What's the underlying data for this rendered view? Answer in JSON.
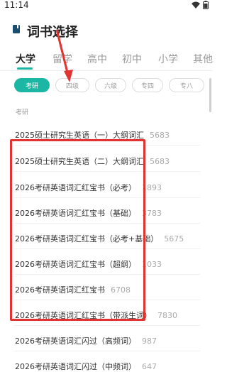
{
  "status": {
    "time": "11:14"
  },
  "header": {
    "title": "词书选择"
  },
  "tabs": [
    {
      "label": "大学",
      "active": true
    },
    {
      "label": "留学",
      "active": false
    },
    {
      "label": "高中",
      "active": false
    },
    {
      "label": "初中",
      "active": false
    },
    {
      "label": "小学",
      "active": false
    },
    {
      "label": "其他",
      "active": false
    }
  ],
  "chips": [
    {
      "label": "考研",
      "active": true
    },
    {
      "label": "四级",
      "active": false
    },
    {
      "label": "六级",
      "active": false
    },
    {
      "label": "专四",
      "active": false
    },
    {
      "label": "专八",
      "active": false
    }
  ],
  "section": {
    "label": "考研"
  },
  "books": [
    {
      "title": "2025硕士研究生英语（一）大纲词汇",
      "count": "5683"
    },
    {
      "title": "2025硕士研究生英语（二）大纲词汇",
      "count": "5683"
    },
    {
      "title": "2026考研英语词汇红宝书（必考）",
      "count": "1893"
    },
    {
      "title": "2026考研英语词汇红宝书（基础）",
      "count": "3783"
    },
    {
      "title": "2026考研英语词汇红宝书（必考+基础）",
      "count": "5675"
    },
    {
      "title": "2026考研英语词汇红宝书（超纲）",
      "count": "1033"
    },
    {
      "title": "2026考研英语词汇红宝书",
      "count": "6708"
    },
    {
      "title": "2026考研英语词汇红宝书（带派生词）",
      "count": "7830"
    },
    {
      "title": "2026考研英语词汇闪过（高频词）",
      "count": "987"
    },
    {
      "title": "2026考研英语词汇闪过（中频词）",
      "count": "647"
    }
  ],
  "colors": {
    "accent": "#1bb7a4",
    "annotation": "#e23333"
  },
  "icons": {
    "book": "book-icon",
    "wifi": "wifi-icon",
    "battery": "battery-icon"
  }
}
